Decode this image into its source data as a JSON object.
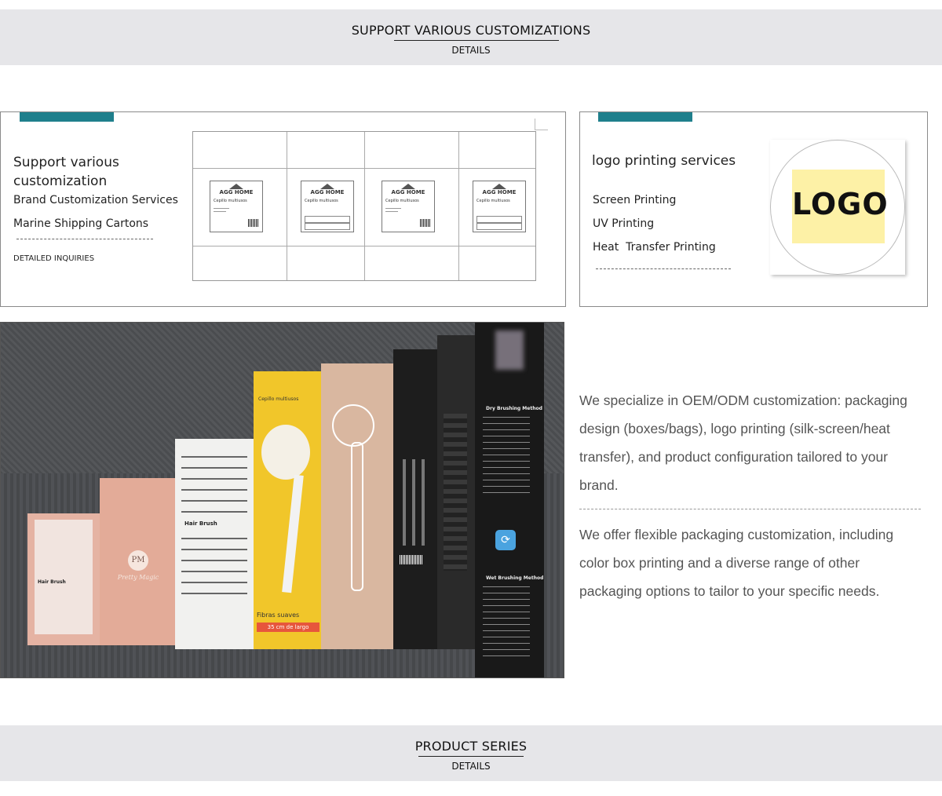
{
  "top_banner": {
    "title": "SUPPORT VARIOUS CUSTOMIZATIONS",
    "subtitle": "DETAILS"
  },
  "card_left": {
    "heading": "Support various customization",
    "items": [
      "Brand Customization Services",
      "Marine Shipping Cartons"
    ],
    "link": "DETAILED INQUIRIES",
    "carton_label": {
      "brand": "AGG HOME",
      "product": "Cepillo multiusos"
    }
  },
  "card_right": {
    "heading": "logo printing services",
    "items": [
      "Screen Printing",
      "UV Printing",
      "Heat  Transfer Printing"
    ],
    "logo_text": "LOGO"
  },
  "photo": {
    "box_texts": {
      "pm_logo": "PM",
      "pm_script": "Pretty Magic",
      "hair_brush": "Hair Brush",
      "cepillo": "Cepillo multiusos",
      "fibras": "Fibras suaves",
      "largo": "35 cm de largo",
      "dry_brushing": "Dry Brushing Method",
      "wet_brushing": "Wet Brushing Method"
    }
  },
  "description": {
    "p1": "We specialize in OEM/ODM customization: packaging design (boxes/bags), logo printing (silk-screen/heat transfer), and product configuration tailored to your brand.",
    "p2": "We offer flexible packaging customization, including color box printing and a diverse range of other packaging options to tailor to your specific needs."
  },
  "bottom_banner": {
    "title": "PRODUCT SERIES",
    "subtitle": "DETAILS"
  },
  "colors": {
    "banner_bg": "#e6e6e9",
    "accent_teal": "#1f7f8c",
    "logo_yellow": "#fdf1a6"
  }
}
